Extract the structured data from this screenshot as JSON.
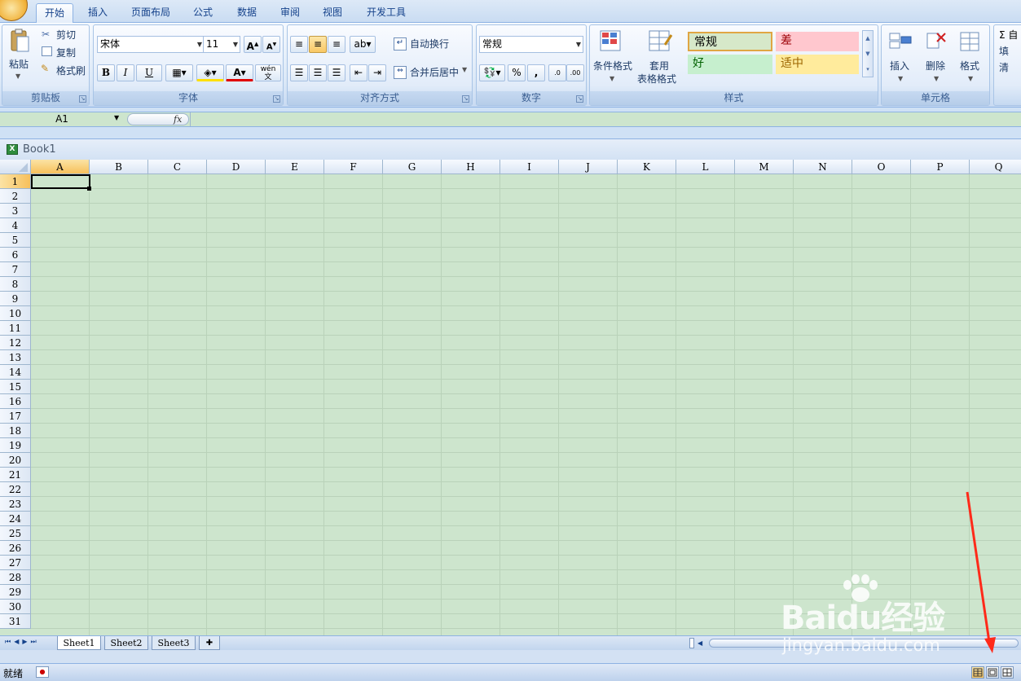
{
  "tabs": [
    "开始",
    "插入",
    "页面布局",
    "公式",
    "数据",
    "审阅",
    "视图",
    "开发工具"
  ],
  "clipboard": {
    "paste": "粘贴",
    "cut": "剪切",
    "copy": "复制",
    "format_painter": "格式刷",
    "label": "剪贴板"
  },
  "font": {
    "name": "宋体",
    "size": "11",
    "label": "字体",
    "bold": "B",
    "italic": "I",
    "underline": "U",
    "phonetic": "wén"
  },
  "alignment": {
    "wrap": "自动换行",
    "merge": "合并后居中",
    "label": "对齐方式"
  },
  "number": {
    "format": "常规",
    "percent": "%",
    "comma": ",",
    "label": "数字"
  },
  "styles": {
    "cond_format": "条件格式",
    "table_line1": "套用",
    "table_line2": "表格格式",
    "normal": "常规",
    "bad": "差",
    "good": "好",
    "neutral": "适中",
    "label": "样式"
  },
  "cells": {
    "insert": "插入",
    "delete": "删除",
    "format": "格式",
    "label": "单元格"
  },
  "editing": {
    "sum": "Σ 自",
    "fill": "填",
    "clear": "清"
  },
  "name_box": "A1",
  "fx": "fx",
  "workbook": "Book1",
  "columns": [
    "A",
    "B",
    "C",
    "D",
    "E",
    "F",
    "G",
    "H",
    "I",
    "J",
    "K",
    "L",
    "M",
    "N",
    "O",
    "P",
    "Q"
  ],
  "rows": [
    "1",
    "2",
    "3",
    "4",
    "5",
    "6",
    "7",
    "8",
    "9",
    "10",
    "11",
    "12",
    "13",
    "14",
    "15",
    "16",
    "17",
    "18",
    "19",
    "20",
    "21",
    "22",
    "23",
    "24",
    "25",
    "26",
    "27",
    "28",
    "29",
    "30",
    "31"
  ],
  "sheets": [
    "Sheet1",
    "Sheet2",
    "Sheet3"
  ],
  "status": "就绪",
  "watermark": {
    "brand": "Baidu经验",
    "url": "jingyan.baidu.com"
  },
  "colors": {
    "grid_bg": "#cde5cd",
    "ribbon": "#dbe8f7",
    "accent": "#f7c05b",
    "arrow": "#ff2a1a"
  }
}
